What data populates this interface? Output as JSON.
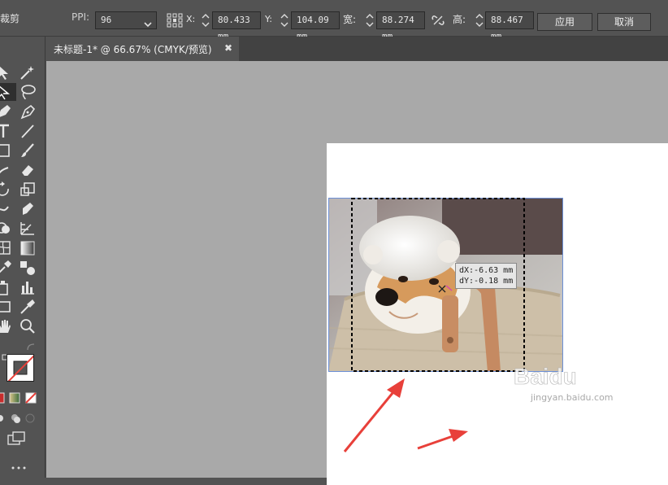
{
  "toolbar_options": {
    "tool_name": "裁剪",
    "ppi_label": "PPI:",
    "ppi_value": "96",
    "x_label": "X:",
    "x_value": "80.433 mm",
    "y_label": "Y:",
    "y_value": "104.09 mm",
    "width_label": "宽:",
    "width_value": "88.274 mm",
    "height_label": "高:",
    "height_value": "88.467 mm",
    "apply_label": "应用",
    "cancel_label": "取消"
  },
  "document_tab": {
    "title": "未标题-1* @ 66.67% (CMYK/预览)",
    "close_glyph": "✖"
  },
  "tools": [
    "selection-arrow",
    "magic-wand",
    "direct-selection",
    "lasso",
    "pen",
    "curvature-pen",
    "type",
    "line",
    "rectangle",
    "paintbrush",
    "pencil",
    "eraser",
    "rotate",
    "scale",
    "warp",
    "free-transform",
    "shape-builder",
    "perspective-grid",
    "mesh",
    "gradient",
    "eyedropper",
    "blend",
    "symbol-sprayer",
    "column-graph",
    "artboard",
    "slice",
    "hand",
    "zoom"
  ],
  "canvas_overlay": {
    "dx_text": "dX:-6.63 mm",
    "dy_text": "dY:-0.18 mm"
  },
  "watermark": {
    "brand": "Baidu",
    "sub": "jingyan.baidu.com"
  },
  "colors": {
    "ui_dark": "#535353",
    "canvas_gray": "#a9a9a9",
    "artboard": "#ffffff",
    "annotation_arrow": "#e8403a",
    "selection_blue": "#6b8fd6"
  }
}
